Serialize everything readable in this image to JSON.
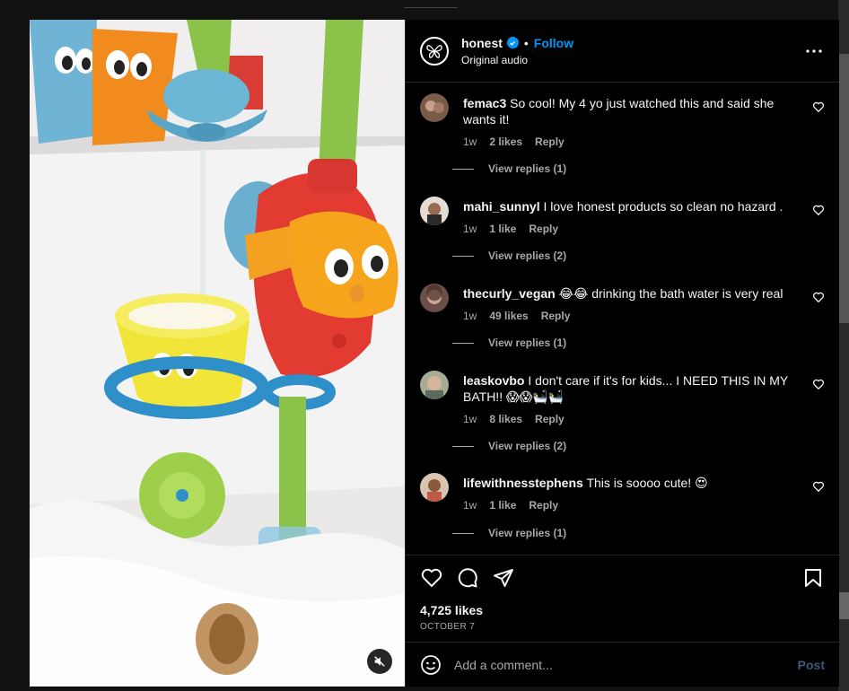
{
  "post": {
    "username": "honest",
    "follow_label": "Follow",
    "dot": "•",
    "audio": "Original audio",
    "likes": "4,725 likes",
    "date": "OCTOBER 7"
  },
  "comments": [
    {
      "username": "femac3",
      "text": "So cool! My 4 yo just watched this and said she wants it!",
      "time": "1w",
      "likes": "2 likes",
      "reply": "Reply",
      "view_replies": "View replies (1)",
      "avatar_color": "#7a5a48"
    },
    {
      "username": "mahi_sunnyl",
      "text": "I love honest products so clean no hazard .",
      "time": "1w",
      "likes": "1 like",
      "reply": "Reply",
      "view_replies": "View replies (2)",
      "avatar_color": "#d8d0c8"
    },
    {
      "username": "thecurly_vegan",
      "text": "😂😂 drinking the bath water is very real",
      "time": "1w",
      "likes": "49 likes",
      "reply": "Reply",
      "view_replies": "View replies (1)",
      "avatar_color": "#8a6a5c"
    },
    {
      "username": "leaskovbo",
      "text": "I don't care if it's for kids... I NEED THIS IN MY BATH!! 😱😱🛀🛀",
      "time": "1w",
      "likes": "8 likes",
      "reply": "Reply",
      "view_replies": "View replies (2)",
      "avatar_color": "#9aa088"
    },
    {
      "username": "lifewithnesstephens",
      "text": "This is soooo cute! 😍",
      "time": "1w",
      "likes": "1 like",
      "reply": "Reply",
      "view_replies": "View replies (1)",
      "avatar_color": "#c0a890"
    }
  ],
  "composer": {
    "placeholder": "Add a comment...",
    "post_label": "Post"
  },
  "colors": {
    "accent": "#0095f6",
    "background": "#000000",
    "secondary_text": "#a8a8a8"
  },
  "icons": [
    "verified-icon",
    "more-options-icon",
    "heart-icon",
    "comment-icon",
    "share-icon",
    "bookmark-icon",
    "emoji-icon",
    "mute-icon"
  ]
}
